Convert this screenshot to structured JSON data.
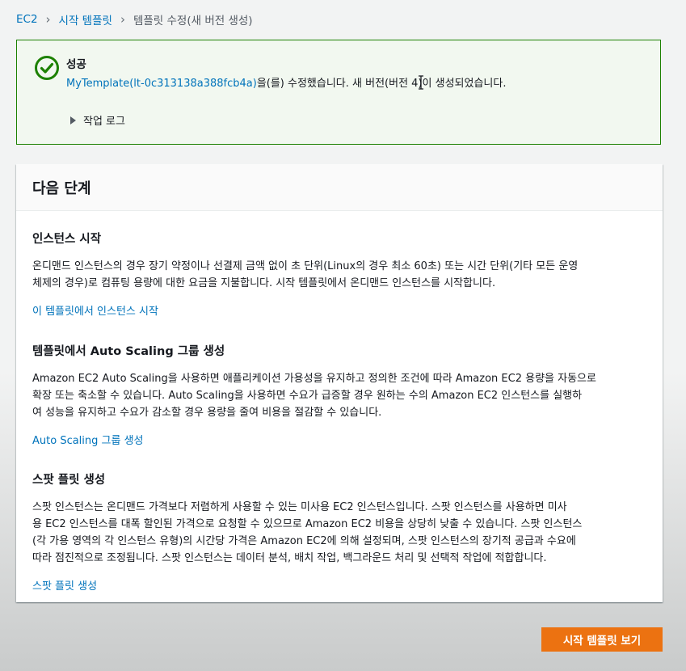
{
  "breadcrumb": {
    "items": [
      "EC2",
      "시작 템플릿"
    ],
    "current": "템플릿 수정(새 버전 생성)"
  },
  "flash": {
    "title": "성공",
    "message_link": "MyTemplate(lt-0c313138a388fcb4a)",
    "message_rest": "을(를) 수정했습니다. 새 버전(버전 4)이 생성되었습니다.",
    "expander_label": "작업 로그",
    "icon": "success-check-icon"
  },
  "panel": {
    "title": "다음 단계",
    "sections": [
      {
        "title": "인스턴스 시작",
        "lines": [
          "온디맨드 인스턴스의 경우 장기 약정이나 선결제 금액 없이 초 단위(Linux의 경우 최소 60초) 또는 시간 단위(기타 모든 운영",
          "체제의 경우)로 컴퓨팅 용량에 대한 요금을 지불합니다. 시작 템플릿에서 온디맨드 인스턴스를 시작합니다."
        ],
        "link": "이 템플릿에서 인스턴스 시작"
      },
      {
        "title": "템플릿에서 Auto Scaling 그룹 생성",
        "lines": [
          "Amazon EC2 Auto Scaling을 사용하면 애플리케이션 가용성을 유지하고 정의한 조건에 따라 Amazon EC2 용량을 자동으로",
          "확장 또는 축소할 수 있습니다. Auto Scaling을 사용하면 수요가 급증할 경우 원하는 수의 Amazon EC2 인스턴스를 실행하",
          "여 성능을 유지하고 수요가 감소할 경우 용량을 줄여 비용을 절감할 수 있습니다."
        ],
        "link": "Auto Scaling 그룹 생성"
      },
      {
        "title": "스팟 플릿 생성",
        "lines": [
          "스팟 인스턴스는 온디맨드 가격보다 저렴하게 사용할 수 있는 미사용 EC2 인스턴스입니다. 스팟 인스턴스를 사용하면 미사",
          "용 EC2 인스턴스를 대폭 할인된 가격으로 요청할 수 있으므로 Amazon EC2 비용을 상당히 낮출 수 있습니다. 스팟 인스턴스",
          "(각 가용 영역의 각 인스턴스 유형)의 시간당 가격은 Amazon EC2에 의해 설정되며, 스팟 인스턴스의 장기적 공급과 수요에",
          "따라 점진적으로 조정됩니다. 스팟 인스턴스는 데이터 분석, 배치 작업, 백그라운드 처리 및 선택적 작업에 적합합니다."
        ],
        "link": "스팟 플릿 생성"
      }
    ]
  },
  "actions": {
    "view_templates_label": "시작 템플릿 보기"
  },
  "colors": {
    "link": "#0073bb",
    "success": "#1d8102",
    "primary_button": "#ec7211"
  }
}
